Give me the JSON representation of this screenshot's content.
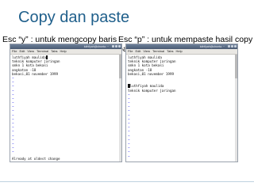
{
  "slide": {
    "title": "Copy dan paste",
    "caption_left": "Esc “y” : untuk mengcopy baris",
    "caption_right": "Esc “p” : untuk mempaste hasil copy baris"
  },
  "terminals": {
    "left": {
      "window_title": "luthfiyah@ubuntu: ~",
      "menu": [
        "File",
        "Edit",
        "View",
        "Terminal",
        "Tabs",
        "Help"
      ],
      "lines": [
        "luthfiyah maulida",
        "teknik komputer jaringan",
        "smkn 1 kota bekasi",
        "angkatan -18",
        "bekasi,01 november 1999"
      ],
      "status": "Already at oldest change"
    },
    "right": {
      "window_title": "luthfiyah@ubuntu: ~",
      "menu": [
        "File",
        "Edit",
        "View",
        "Terminal",
        "Tabs",
        "Help"
      ],
      "lines": [
        "luthfiyah maulida",
        "teknik komputer jaringan",
        "smkn 1 kota bekasi",
        "angkatan -18",
        "bekasi,01 november 1999",
        "",
        "",
        "luthfiyah maulida",
        "teknik komputer jaringan"
      ],
      "status": ""
    },
    "tilde": "~"
  }
}
